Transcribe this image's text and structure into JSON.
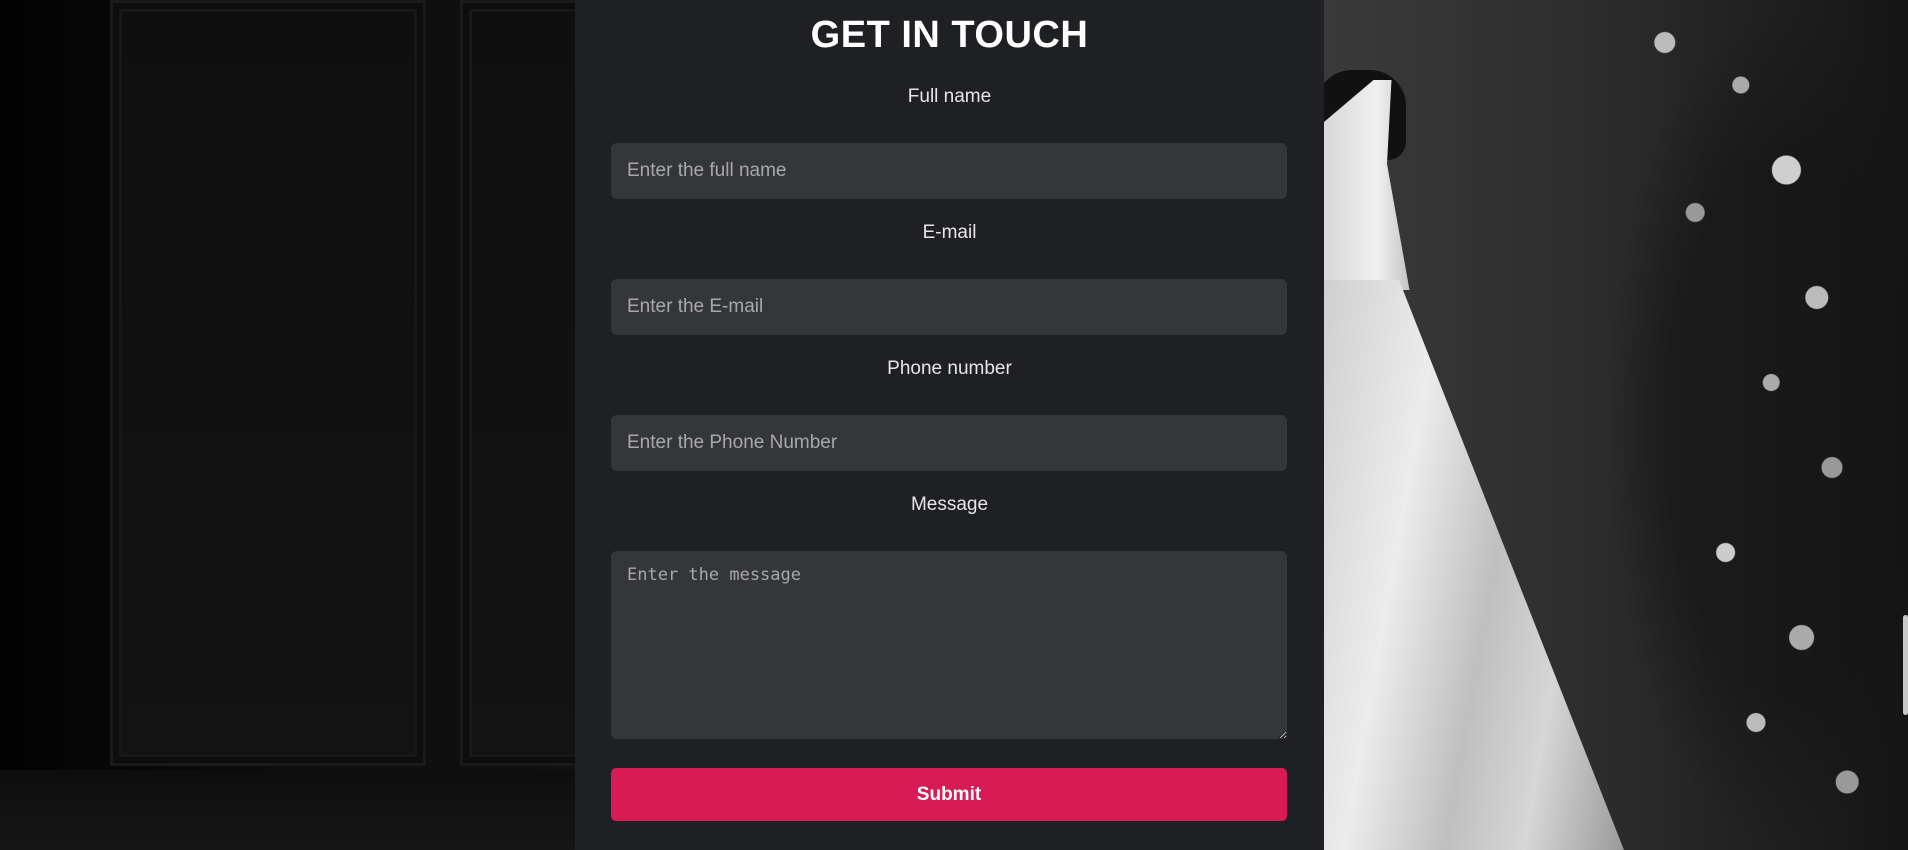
{
  "form": {
    "title": "GET IN TOUCH",
    "full_name": {
      "label": "Full name",
      "placeholder": "Enter the full name"
    },
    "email": {
      "label": "E-mail",
      "placeholder": "Enter the E-mail"
    },
    "phone": {
      "label": "Phone number",
      "placeholder": "Enter the Phone Number"
    },
    "message": {
      "label": "Message",
      "placeholder": "Enter the message"
    },
    "submit_label": "Submit"
  },
  "colors": {
    "panel_bg": "#1f2023",
    "input_bg": "#35363a",
    "submit_accent": "#d81b55"
  }
}
